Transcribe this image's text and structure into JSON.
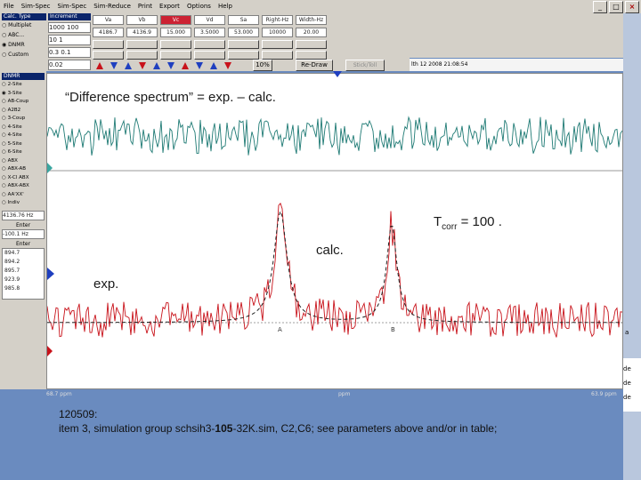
{
  "menu": [
    "File",
    "Sim-Spec",
    "Sim-Spec",
    "Sim-Reduce",
    "Print",
    "Export",
    "Options",
    "Help"
  ],
  "window_buttons": {
    "minimize": "_",
    "maximize": "□",
    "close": "×"
  },
  "calc_type": {
    "title": "Calc. Type",
    "options": [
      "Multiplet",
      "ABC...",
      "DNMR",
      "Custom"
    ],
    "selected": "DNMR"
  },
  "increment": {
    "title": "Increment",
    "rows": [
      "1000 100",
      "10 1",
      "0.3 0.1",
      "0.02"
    ]
  },
  "param_headers": [
    "Va",
    "Vb",
    "Vc",
    "Vd",
    "Sa",
    "Right-Hz",
    "Width-Hz"
  ],
  "param_values": [
    "4186.7",
    "4136.9",
    "15.000",
    "3.5000",
    "53.000",
    "10000",
    "20.00"
  ],
  "toolbar": {
    "zoom": "10%",
    "redraw": "Re-Draw",
    "stick_toll": "Stick/Toll",
    "timestamp": "lth 12 2008  21:08:54"
  },
  "dnmr": {
    "title": "DNMR",
    "options": [
      "2-Site",
      "3-Site",
      "AB-Coup",
      "A2B2",
      "3-Coup",
      "4-Site",
      "4-Site",
      "5-Site",
      "6-Site",
      "ABX",
      "ABX-AB",
      "X-Cl ABX",
      "ABX-ABX",
      "AA'XX'",
      "Indiv"
    ],
    "selected": "3-Site",
    "freq": "4136.76 Hz",
    "enter_label": "Enter",
    "enter_value": "-100.1 Hz",
    "list_label": "Enter",
    "list_values": [
      "894.7",
      "894.2",
      "895.7",
      "923.9",
      "985.8"
    ]
  },
  "annotations": {
    "difference": "“Difference spectrum” = exp. – calc.",
    "tcorr_prefix": "T",
    "tcorr_sub": "corr",
    "tcorr_suffix": " = 100 .",
    "calc": "calc.",
    "exp": "exp.",
    "peak_a": "A",
    "peak_b": "B"
  },
  "axis": {
    "left": "68.7 ppm",
    "mid": "ppm",
    "right": "63.9 ppm"
  },
  "caption": {
    "line1": "120509:",
    "line2_pre": "item 3, simulation group schsih3-",
    "line2_bold": "105",
    "line2_post": "-32K.sim,  C2,C6; see parameters above and/or in table;"
  },
  "right_strip": [
    "a",
    "de",
    "de",
    "de"
  ],
  "colors": {
    "difference": "#1e7a74",
    "experimental": "#c8121a",
    "calc": "#222222",
    "background": "#6a8bbf",
    "panel": "#d4d0c8"
  }
}
